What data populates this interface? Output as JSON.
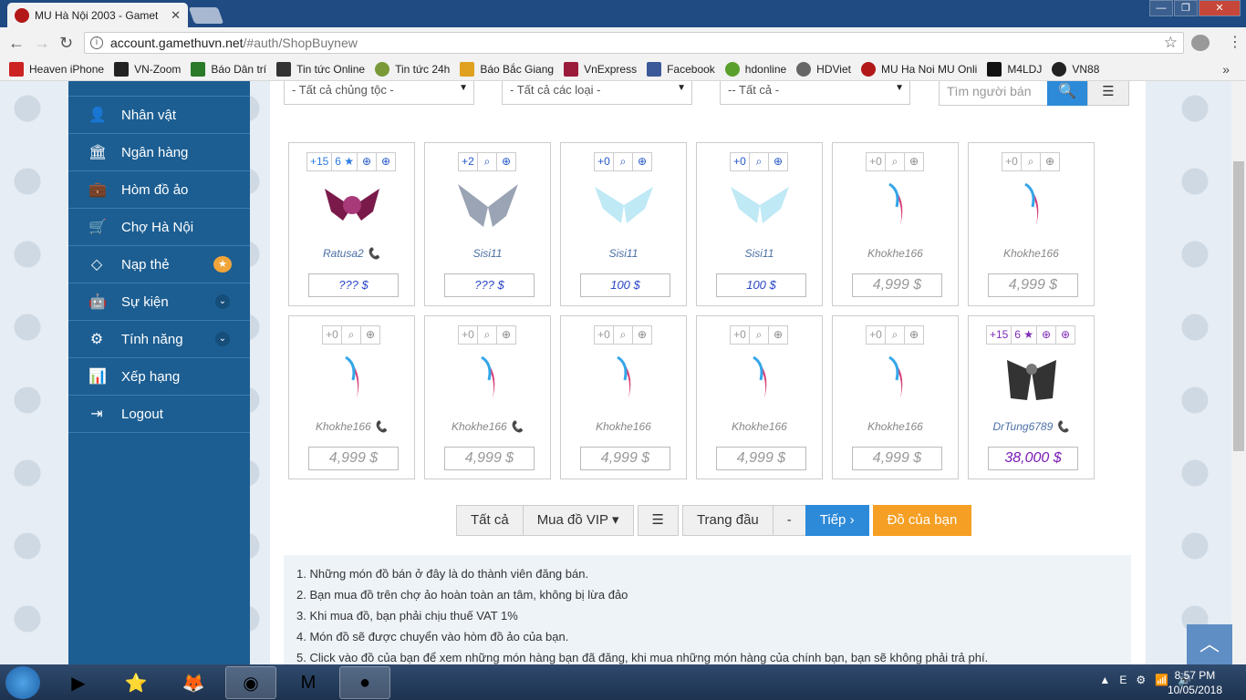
{
  "browser": {
    "tab_title": "MU Hà Nội 2003 - Gamet",
    "url_domain": "account.gamethuvn.net",
    "url_path": "/#auth/ShopBuynew",
    "bookmarks": [
      "Heaven iPhone",
      "VN-Zoom",
      "Báo Dân trí",
      "Tin tức Online",
      "Tin tức 24h",
      "Báo Bắc Giang",
      "VnExpress",
      "Facebook",
      "hdonline",
      "HDViet",
      "MU Ha Noi MU Onli",
      "M4LDJ",
      "VN88"
    ],
    "more": "»"
  },
  "sidebar": {
    "items": [
      {
        "label": "Nhân vật",
        "icon": "user-icon"
      },
      {
        "label": "Ngân hàng",
        "icon": "bank-icon"
      },
      {
        "label": "Hòm đồ ảo",
        "icon": "briefcase-icon"
      },
      {
        "label": "Chợ Hà Nội",
        "icon": "cart-icon"
      },
      {
        "label": "Nạp thẻ",
        "icon": "diamond-icon",
        "badge": "★"
      },
      {
        "label": "Sự kiện",
        "icon": "android-icon"
      },
      {
        "label": "Tính năng",
        "icon": "gears-icon"
      },
      {
        "label": "Xếp hạng",
        "icon": "bar-chart-icon"
      },
      {
        "label": "Logout",
        "icon": "logout-icon"
      }
    ]
  },
  "filters": {
    "race": "- Tất cả chủng tộc -",
    "type": "- Tất cả các loại -",
    "all": "-- Tất cả -",
    "search_placeholder": "Tìm người bán"
  },
  "items": [
    {
      "level": "+15",
      "stars": "6 ★",
      "seller": "Ratusa2 📞",
      "price": "??? $",
      "img": "wings-dark"
    },
    {
      "level": "+2",
      "stars": "",
      "seller": "Sisi11",
      "price": "??? $",
      "img": "wings-silver"
    },
    {
      "level": "+0",
      "stars": "",
      "seller": "Sisi11",
      "price": "100 $",
      "img": "wings-blue"
    },
    {
      "level": "+0",
      "stars": "",
      "seller": "Sisi11",
      "price": "100 $",
      "img": "wings-blue"
    },
    {
      "level": "+0",
      "stars": "",
      "seller": "Khokhe166",
      "price": "4,999 $",
      "img": "feather"
    },
    {
      "level": "+0",
      "stars": "",
      "seller": "Khokhe166",
      "price": "4,999 $",
      "img": "feather"
    },
    {
      "level": "+0",
      "stars": "",
      "seller": "Khokhe166 📞",
      "price": "4,999 $",
      "img": "feather"
    },
    {
      "level": "+0",
      "stars": "",
      "seller": "Khokhe166 📞",
      "price": "4,999 $",
      "img": "feather"
    },
    {
      "level": "+0",
      "stars": "",
      "seller": "Khokhe166",
      "price": "4,999 $",
      "img": "feather"
    },
    {
      "level": "+0",
      "stars": "",
      "seller": "Khokhe166",
      "price": "4,999 $",
      "img": "feather"
    },
    {
      "level": "+0",
      "stars": "",
      "seller": "Khokhe166",
      "price": "4,999 $",
      "img": "feather"
    },
    {
      "level": "+15",
      "stars": "6 ★",
      "seller": "DrTung6789 📞",
      "price": "38,000 $",
      "img": "wings-black"
    }
  ],
  "pager": {
    "all": "Tất cả",
    "vip": "Mua đồ VIP ▾",
    "first": "Trang đầu",
    "dash": "-",
    "next": "Tiếp ›",
    "mine": "Đồ của bạn"
  },
  "notes": [
    "1. Những món đồ bán ở đây là do thành viên đăng bán.",
    "2. Bạn mua đồ trên chợ ảo hoàn toàn an tâm, không bị lừa đảo",
    "3. Khi mua đồ, bạn phải chịu thuế VAT 1%",
    "4. Món đồ sẽ được chuyển vào hòm đồ ảo của bạn.",
    "5. Click vào đồ của bạn để xem những món hàng bạn đã đăng, khi mua những món hàng của chính bạn, bạn sẽ không phải trả phí."
  ],
  "clock": {
    "time": "8:57 PM",
    "date": "10/05/2018"
  }
}
